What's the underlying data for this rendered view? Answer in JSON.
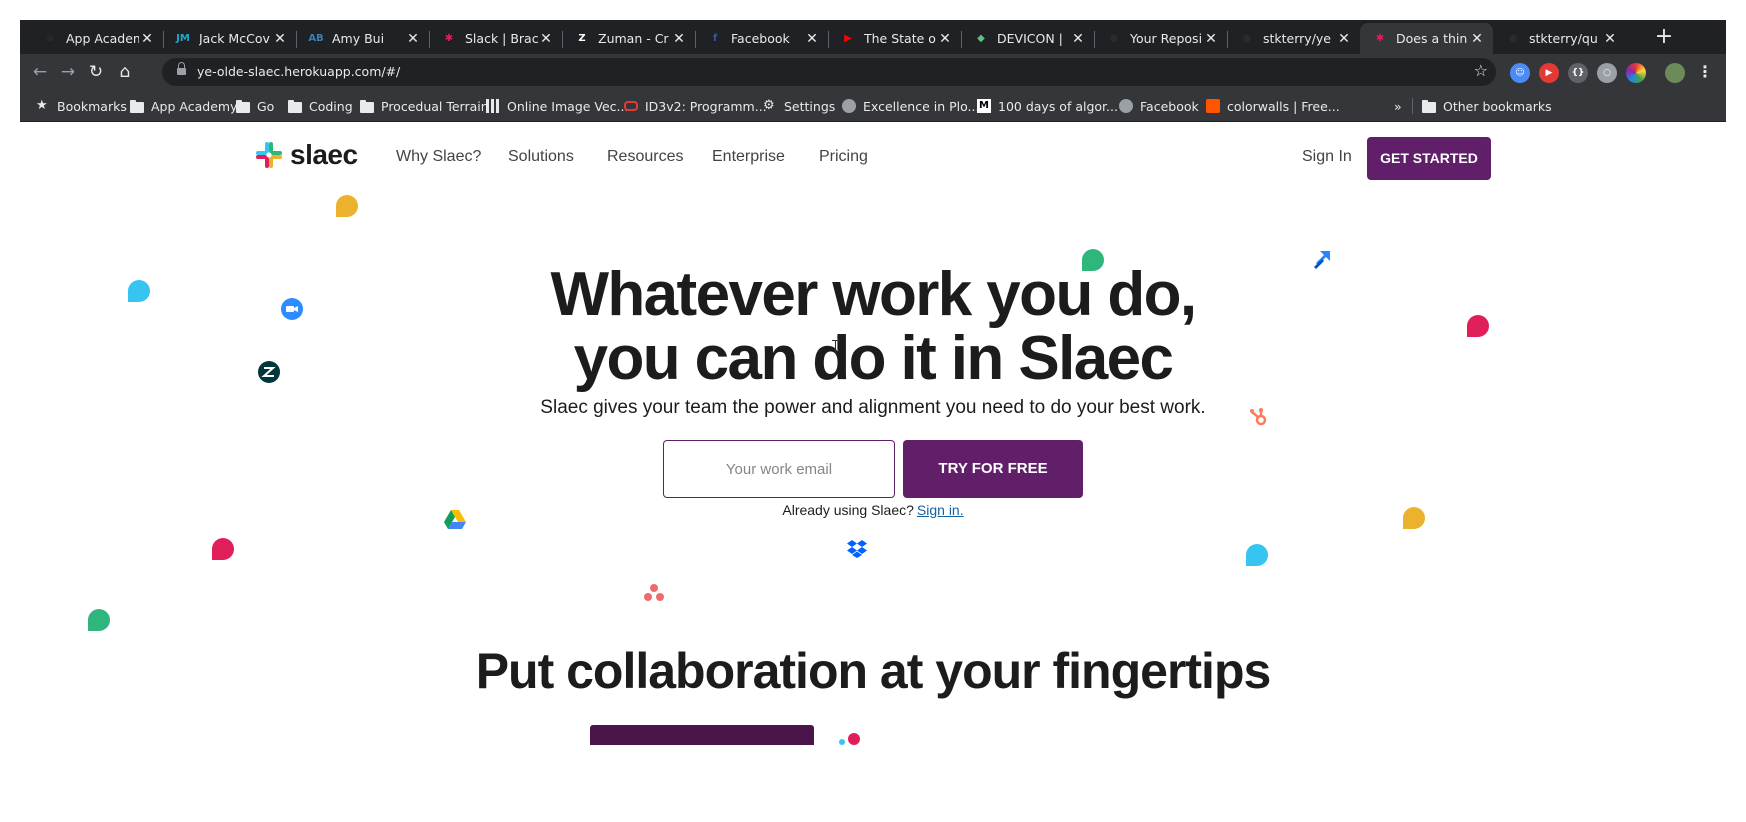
{
  "browser": {
    "tabs": [
      {
        "title": "App Academ",
        "icon_name": "app-academy-icon",
        "icon_text": "a",
        "icon_color": "#2b2b2b"
      },
      {
        "title": "Jack McCov",
        "icon_name": "jm-icon",
        "icon_text": "JM",
        "icon_color": "#1fa8c9"
      },
      {
        "title": "Amy Bui",
        "icon_name": "ab-icon",
        "icon_text": "AB",
        "icon_color": "#3a7fb5"
      },
      {
        "title": "Slack | Brac",
        "icon_name": "slack-icon",
        "icon_text": "✱",
        "icon_color": "#e01e5a"
      },
      {
        "title": "Zuman - Cr",
        "icon_name": "zuman-icon",
        "icon_text": "Z",
        "icon_color": "#ffffff"
      },
      {
        "title": "Facebook",
        "icon_name": "facebook-icon",
        "icon_text": "f",
        "icon_color": "#3b5998"
      },
      {
        "title": "The State o",
        "icon_name": "youtube-icon",
        "icon_text": "▶",
        "icon_color": "#ff0000"
      },
      {
        "title": "DEVICON |",
        "icon_name": "devicon-icon",
        "icon_text": "◆",
        "icon_color": "#60be86"
      },
      {
        "title": "Your Reposi",
        "icon_name": "github-icon",
        "icon_text": "●",
        "icon_color": "#2b2b2b"
      },
      {
        "title": "stkterry/ye",
        "icon_name": "github-icon",
        "icon_text": "●",
        "icon_color": "#2b2b2b"
      },
      {
        "title": "Does a thin",
        "icon_name": "slack-icon",
        "icon_text": "✱",
        "icon_color": "#e01e5a",
        "active": true
      },
      {
        "title": "stkterry/qu",
        "icon_name": "github-icon",
        "icon_text": "●",
        "icon_color": "#2b2b2b"
      }
    ],
    "url": "ye-olde-slaec.herokuapp.com/#/",
    "bookmarks": [
      {
        "label": "Bookmarks",
        "icon": "star-icon"
      },
      {
        "label": "App Academy",
        "icon": "folder-icon"
      },
      {
        "label": "Go",
        "icon": "folder-icon"
      },
      {
        "label": "Coding",
        "icon": "folder-icon"
      },
      {
        "label": "Procedual Terrain",
        "icon": "folder-icon"
      },
      {
        "label": "Online Image Vec...",
        "icon": "image-vector-icon"
      },
      {
        "label": "ID3v2: Programm...",
        "icon": "oracle-icon"
      },
      {
        "label": "Settings",
        "icon": "gear-icon"
      },
      {
        "label": "Excellence in Plo...",
        "icon": "globe-icon"
      },
      {
        "label": "100 days of algor...",
        "icon": "medium-icon"
      },
      {
        "label": "Facebook",
        "icon": "globe-icon"
      },
      {
        "label": "colorwalls | Free...",
        "icon": "soundcloud-icon"
      },
      {
        "label": "Other bookmarks",
        "icon": "folder-icon"
      }
    ],
    "overflow_label": "»"
  },
  "site": {
    "logo_text": "slaec",
    "nav": [
      "Why Slaec?",
      "Solutions",
      "Resources",
      "Enterprise",
      "Pricing"
    ],
    "sign_in": "Sign In",
    "get_started": "GET STARTED",
    "hero": {
      "title_line1": "Whatever work you do,",
      "title_line2": "you can do it in Slaec",
      "subtitle": "Slaec gives your team the power and alignment you need to do your best work.",
      "email_placeholder": "Your work email",
      "try_button": "TRY FOR FREE",
      "already_text": "Already using Slaec?",
      "sign_in_link": "Sign in."
    },
    "section_title": "Put collaboration at your fingertips"
  },
  "colors": {
    "aubergine": "#611f69",
    "link": "#1264a3",
    "slack_blue": "#36c5f0",
    "slack_green": "#2eb67d",
    "slack_yellow": "#ecb22e",
    "slack_red": "#e01e5a"
  }
}
